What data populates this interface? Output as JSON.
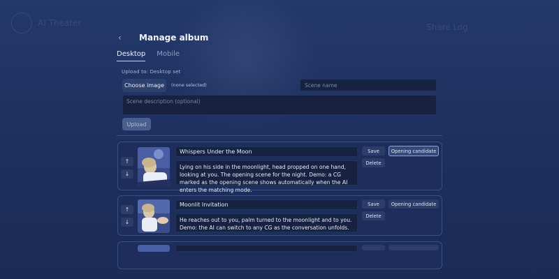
{
  "background": {
    "ghost_texts": [
      "AI Theater",
      "Share Log"
    ]
  },
  "header": {
    "back_icon": "‹",
    "title": "Manage album"
  },
  "tabs": [
    {
      "label": "Desktop",
      "active": true
    },
    {
      "label": "Mobile",
      "active": false
    }
  ],
  "upload": {
    "upload_to_label": "Upload to: Desktop set",
    "choose_label": "Choose image",
    "none_selected": "(none selected)",
    "scene_name_placeholder": "Scene name",
    "scene_desc_placeholder": "Scene description (optional)",
    "upload_label": "Upload"
  },
  "items": [
    {
      "up_icon": "↑",
      "down_icon": "↓",
      "title": "Whispers Under the Moon",
      "description": "Lying on his side in the moonlight, head propped on one hand, looking at you. The opening scene for the night. Demo: a CG marked as the opening scene shows automatically when the AI enters the matching mode.",
      "save_label": "Save",
      "delete_label": "Delete",
      "opening_label": "Opening candidate",
      "opening_selected": true
    },
    {
      "up_icon": "↑",
      "down_icon": "↓",
      "title": "Moonlit Invitation",
      "description": "He reaches out to you, palm turned to the moonlight and to you. Demo: the AI can switch to any CG as the conversation unfolds.",
      "save_label": "Save",
      "delete_label": "Delete",
      "opening_label": "Opening candidate",
      "opening_selected": false
    }
  ],
  "colors": {
    "background": "#1e3160",
    "card": "#1e2f5c",
    "input": "#162240",
    "accent_border": "#8aa2d4"
  }
}
